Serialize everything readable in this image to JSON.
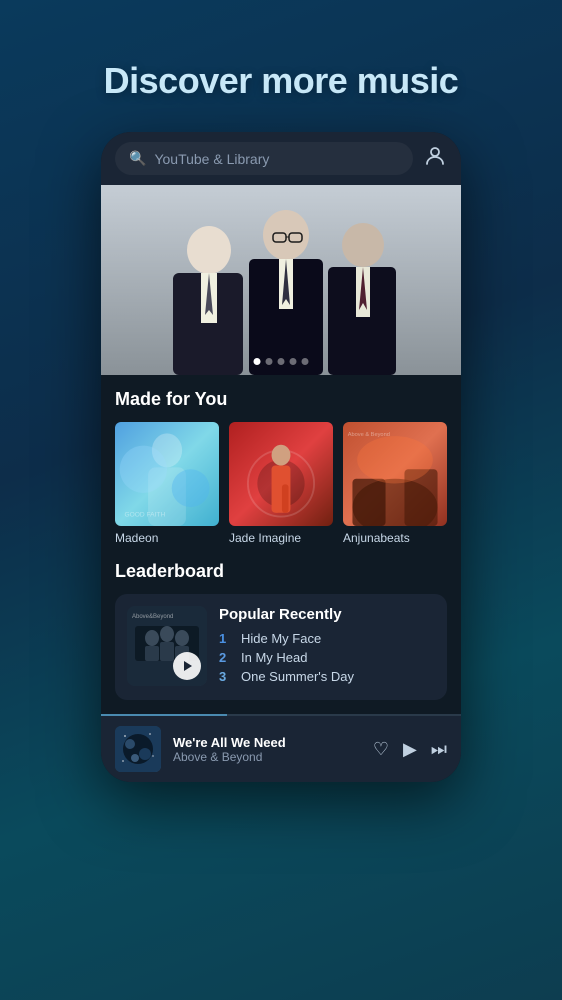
{
  "page": {
    "title": "Discover more music"
  },
  "search": {
    "placeholder": "YouTube & Library"
  },
  "hero": {
    "dots": [
      true,
      false,
      false,
      false,
      false
    ]
  },
  "made_for_you": {
    "title": "Made for You",
    "cards": [
      {
        "label": "Madeon"
      },
      {
        "label": "Jade Imagine"
      },
      {
        "label": "Anjunabeats"
      }
    ]
  },
  "leaderboard": {
    "title": "Leaderboard",
    "card_title": "Popular Recently",
    "tracks": [
      {
        "num": "1",
        "name": "Hide My Face"
      },
      {
        "num": "2",
        "name": "In My Head"
      },
      {
        "num": "3",
        "name": "One Summer's Day"
      }
    ]
  },
  "mini_player": {
    "track": "We're All We Need",
    "artist": "Above & Beyond",
    "icons": {
      "heart": "♡",
      "play": "▶",
      "skip": "⏭"
    }
  }
}
